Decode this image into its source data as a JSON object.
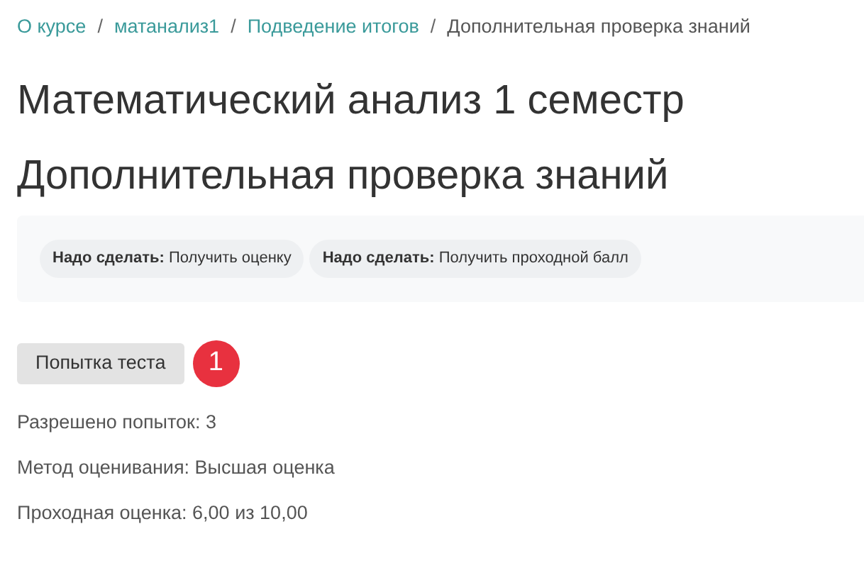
{
  "breadcrumb": [
    {
      "label": "О курсе",
      "kind": "link",
      "separator": "/"
    },
    {
      "label": "матанализ1",
      "kind": "link",
      "separator": "/"
    },
    {
      "label": "Подведение итогов",
      "kind": "link",
      "separator": "/"
    },
    {
      "label": "Дополнительная проверка знаний",
      "kind": "current"
    }
  ],
  "course_title": "Математический анализ 1 семестр",
  "activity_title": "Дополнительная проверка знаний",
  "completion": [
    {
      "text": "**Надо сделать:** Получить оценку"
    },
    {
      "text": "**Надо сделать:** Получить проходной балл"
    }
  ],
  "attempt_button": "Попытка теста",
  "marker": "1",
  "info": [
    "Разрешено попыток: 3",
    "Метод оценивания: Высшая оценка",
    "Проходная оценка: 6,00 из 10,00"
  ]
}
